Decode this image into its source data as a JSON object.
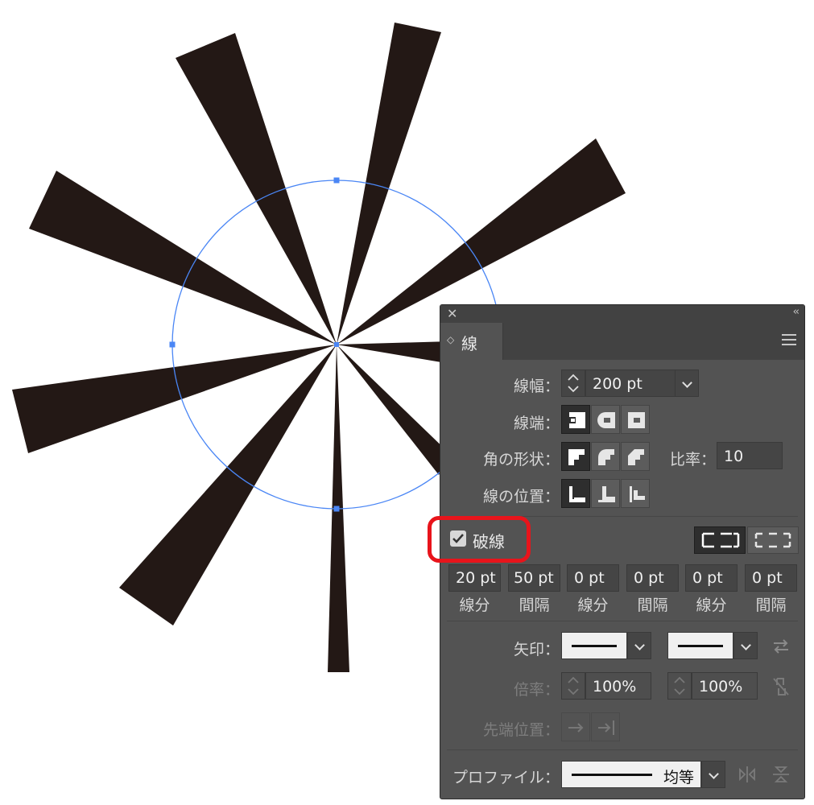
{
  "panel": {
    "title": "線",
    "stroke_weight": {
      "label": "線幅：",
      "value": "200 pt"
    },
    "cap": {
      "label": "線端：",
      "selected_index": 0,
      "icons": [
        "butt-cap-icon",
        "round-cap-icon",
        "projecting-cap-icon"
      ]
    },
    "corner": {
      "label": "角の形状：",
      "selected_index": 0,
      "icons": [
        "miter-join-icon",
        "round-join-icon",
        "bevel-join-icon"
      ],
      "limit_label": "比率：",
      "limit_value": "10"
    },
    "align": {
      "label": "線の位置：",
      "selected_index": 0,
      "icons": [
        "align-center-icon",
        "align-inside-icon",
        "align-outside-icon"
      ]
    },
    "dashed": {
      "label": "破線",
      "checked": true,
      "highlight_color": "#e8141b"
    },
    "dashes": [
      {
        "value": "20 pt",
        "caption": "線分"
      },
      {
        "value": "50 pt",
        "caption": "間隔"
      },
      {
        "value": "0 pt",
        "caption": "線分"
      },
      {
        "value": "0 pt",
        "caption": "間隔"
      },
      {
        "value": "0 pt",
        "caption": "線分"
      },
      {
        "value": "0 pt",
        "caption": "間隔"
      }
    ],
    "arrows": {
      "label": "矢印："
    },
    "scale": {
      "label": "倍率：",
      "start": "100%",
      "end": "100%"
    },
    "arrow_align": {
      "label": "先端位置："
    },
    "profile": {
      "label": "プロファイル：",
      "value": "均等"
    }
  },
  "colors": {
    "artwork": "#231815",
    "selection": "#4a86f5",
    "panel_bg": "#535353"
  }
}
